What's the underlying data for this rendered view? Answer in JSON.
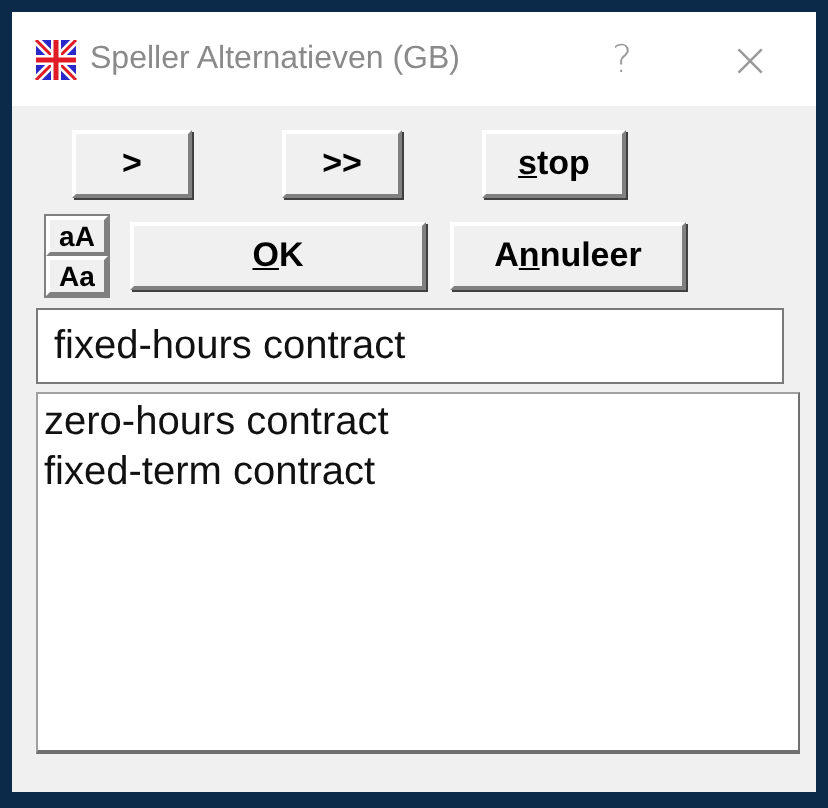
{
  "window": {
    "title": "Speller Alternatieven (GB)",
    "help": "?",
    "close": "×"
  },
  "nav_buttons": [
    {
      "before": ">"
    },
    {
      "before": ">>"
    },
    {
      "key": "s",
      "after": "top"
    }
  ],
  "case_buttons": [
    "aA",
    "Aa"
  ],
  "action_buttons": [
    {
      "key": "O",
      "after": "K"
    },
    {
      "before": "A",
      "key": "n",
      "after": "nuleer"
    }
  ],
  "word_field": {
    "value": "fixed-hours contract"
  },
  "alternatives": [
    {
      "label": "zero-hours contract",
      "selected": false
    },
    {
      "label": "fixed-term contract",
      "selected": false
    }
  ]
}
